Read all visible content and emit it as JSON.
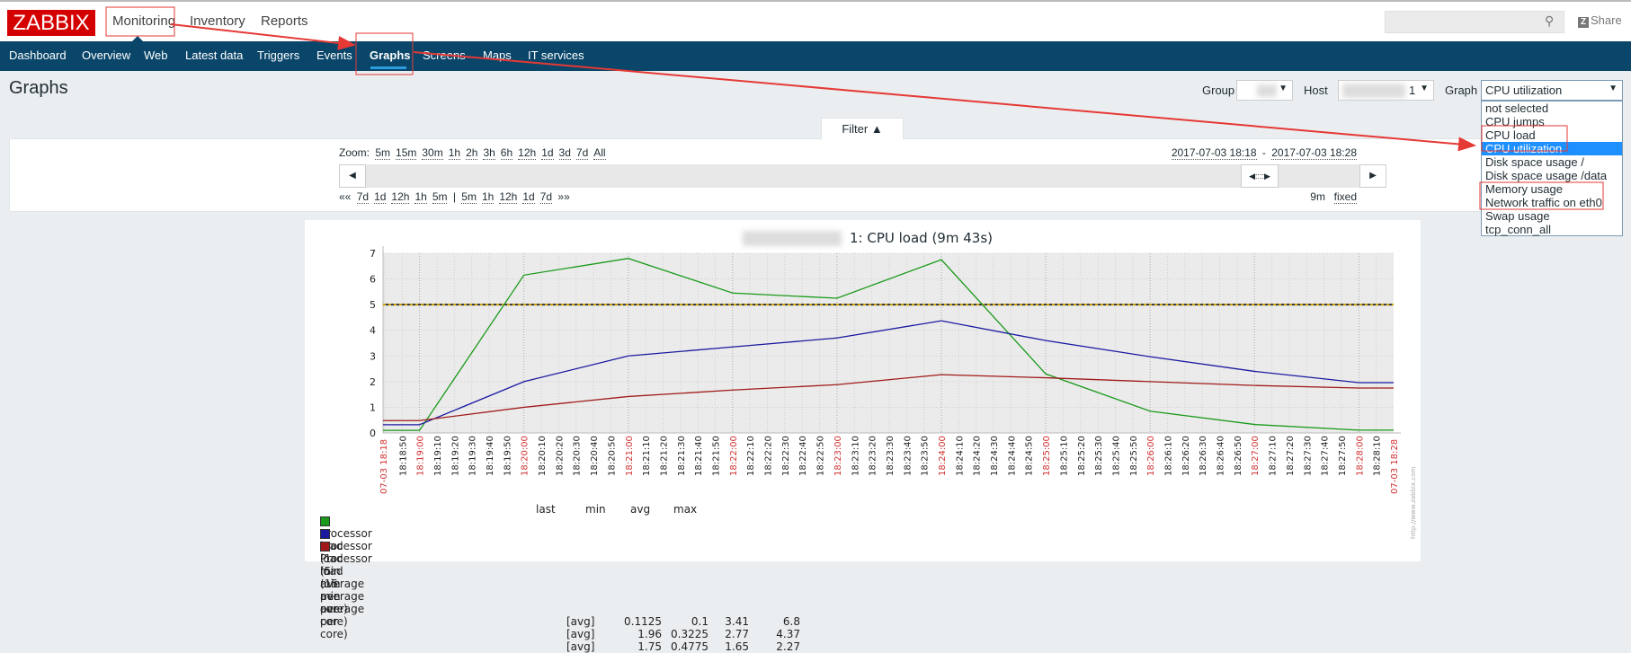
{
  "header": {
    "logo": "ZABBIX",
    "menu": [
      "Monitoring",
      "Inventory",
      "Reports"
    ],
    "search_placeholder": "",
    "share": "Share"
  },
  "nav": {
    "items": [
      "Dashboard",
      "Overview",
      "Web",
      "Latest data",
      "Triggers",
      "Events",
      "Graphs",
      "Screens",
      "Maps",
      "IT services"
    ],
    "active": "Graphs",
    "bg": "#0a466a"
  },
  "page": {
    "title": "Graphs"
  },
  "filters": {
    "group_label": "Group",
    "host_label": "Host",
    "host_suffix": "1",
    "graph_label": "Graph",
    "graph_value": "CPU utilization",
    "graph_options": [
      "not selected",
      "CPU jumps",
      "CPU load",
      "CPU utilization",
      "Disk space usage /",
      "Disk space usage /data",
      "Memory usage",
      "Network traffic on eth0",
      "Swap usage",
      "tcp_conn_all"
    ],
    "highlighted": "CPU utilization"
  },
  "filter_panel": {
    "tab": "Filter ▲",
    "zoom_label": "Zoom:",
    "zoom": [
      "5m",
      "15m",
      "30m",
      "1h",
      "2h",
      "3h",
      "6h",
      "12h",
      "1d",
      "3d",
      "7d",
      "All"
    ],
    "range_from": "2017-07-03 18:18",
    "range_sep": " - ",
    "range_to": "2017-07-03 18:28",
    "back_start": "««",
    "back": [
      "7d",
      "1d",
      "12h",
      "1h",
      "5m"
    ],
    "sep": "|",
    "fwd": [
      "5m",
      "1h",
      "12h",
      "1d",
      "7d"
    ],
    "fwd_end": "»»",
    "period": "9m",
    "fixed": "fixed"
  },
  "chart_data": {
    "type": "line",
    "title": "1: CPU load (9m 43s)",
    "xlabel": "",
    "ylabel": "",
    "ylim": [
      0,
      7
    ],
    "yticks": [
      0,
      1,
      2,
      3,
      4,
      5,
      6,
      7
    ],
    "xrange": [
      "18:18:39",
      "18:28:20"
    ],
    "grid": true,
    "x_start_label": "07-03 18:18",
    "x_end_label": "07-03 18:28",
    "trigger_line": {
      "value": 5,
      "color": "#c8a000"
    },
    "x": [
      "18:18:39",
      "18:19:00",
      "18:20:00",
      "18:21:00",
      "18:22:00",
      "18:23:00",
      "18:24:00",
      "18:25:00",
      "18:26:00",
      "18:27:00",
      "18:28:00",
      "18:28:20"
    ],
    "series": [
      {
        "name": "Processor load (1 min average per core)",
        "color": "#1a9a1a",
        "func": "[avg]",
        "last": "0.1125",
        "min": "0.1",
        "avg": "3.41",
        "max": "6.8",
        "values": [
          0.1,
          0.1,
          6.15,
          6.8,
          5.45,
          5.25,
          6.75,
          2.3,
          0.85,
          0.33,
          0.11,
          0.11
        ]
      },
      {
        "name": "Processor load (5 min average per core)",
        "color": "#1a1aa0",
        "func": "[avg]",
        "last": "1.96",
        "min": "0.3225",
        "avg": "2.77",
        "max": "4.37",
        "values": [
          0.32,
          0.32,
          2.0,
          3.0,
          3.35,
          3.7,
          4.37,
          3.6,
          2.97,
          2.4,
          1.96,
          1.96
        ]
      },
      {
        "name": "Processor load (15 min average per core)",
        "color": "#a01a1a",
        "func": "[avg]",
        "last": "1.75",
        "min": "0.4775",
        "avg": "1.65",
        "max": "2.27",
        "values": [
          0.48,
          0.48,
          1.0,
          1.42,
          1.67,
          1.88,
          2.27,
          2.15,
          2.0,
          1.85,
          1.75,
          1.75
        ]
      }
    ],
    "legend_headers": [
      "last",
      "min",
      "avg",
      "max"
    ],
    "watermark": "http://www.zabbix.com"
  }
}
